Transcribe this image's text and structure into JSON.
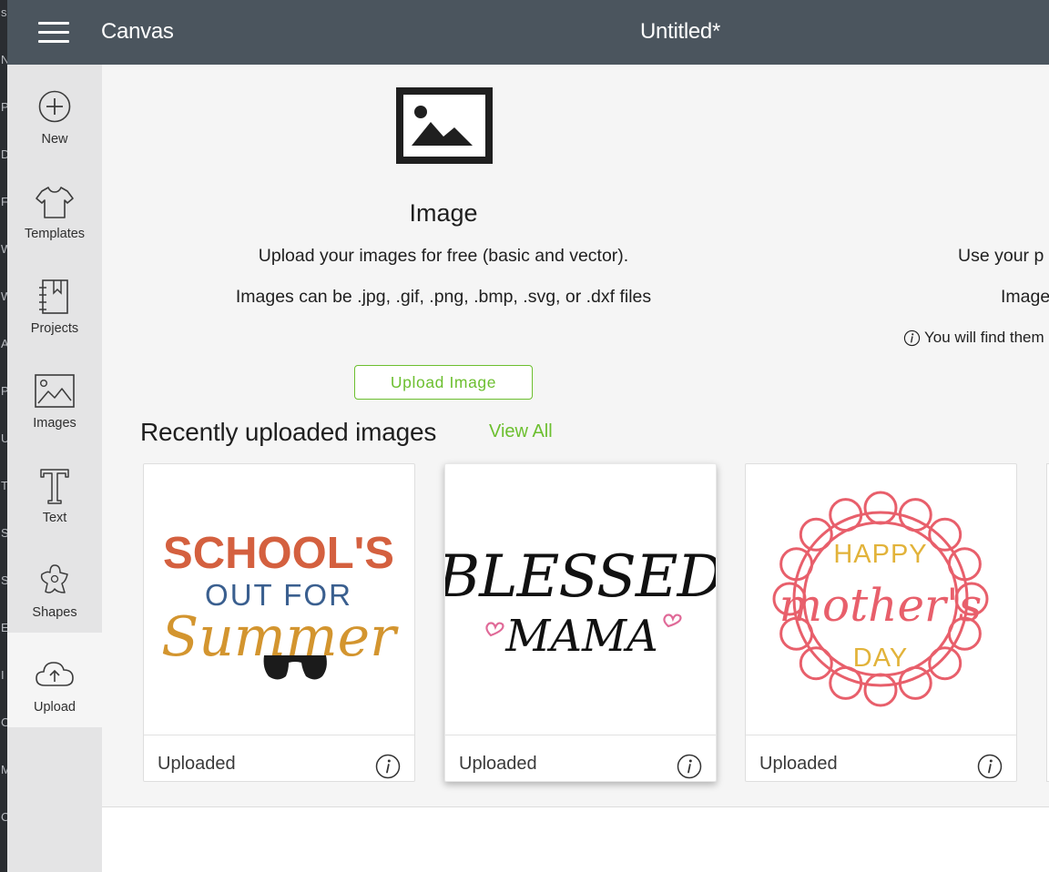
{
  "window": {
    "app_name": "Canvas",
    "doc_title": "Untitled*"
  },
  "edge_letters": [
    "s",
    "N",
    "P",
    "D",
    "F",
    "W",
    "W",
    "A",
    "P",
    "U",
    "T",
    "S",
    "S",
    "E",
    "I",
    "C",
    "M",
    "C"
  ],
  "sidebar": {
    "items": [
      {
        "label": "New",
        "icon": "plus-circle-icon"
      },
      {
        "label": "Templates",
        "icon": "tshirt-icon"
      },
      {
        "label": "Projects",
        "icon": "notebook-icon"
      },
      {
        "label": "Images",
        "icon": "image-icon"
      },
      {
        "label": "Text",
        "icon": "text-t-icon"
      },
      {
        "label": "Shapes",
        "icon": "shapes-icon"
      },
      {
        "label": "Upload",
        "icon": "cloud-upload-icon"
      }
    ],
    "active": "Upload"
  },
  "image_section": {
    "title": "Image",
    "line1": "Upload your images for free (basic and vector).",
    "line2": "Images can be .jpg, .gif, .png, .bmp, .svg, or .dxf files",
    "upload_button": "Upload Image"
  },
  "right_section": {
    "line1": "Use your p",
    "line2": "Image",
    "note": "You will find them"
  },
  "recent": {
    "title": "Recently uploaded images",
    "view_all": "View All",
    "cards": [
      {
        "status": "Uploaded",
        "art": {
          "line1": "SCHOOL'S",
          "line2": "OUT FOR",
          "line3": "Summer"
        }
      },
      {
        "status": "Uploaded",
        "art": {
          "line1": "BLESSED",
          "line2": "MAMA"
        }
      },
      {
        "status": "Uploaded",
        "art": {
          "line1": "HAPPY",
          "line2": "mother's",
          "line3": "DAY"
        }
      }
    ]
  },
  "colors": {
    "topbar": "#4b555e",
    "accent_green": "#6cbf2f",
    "sidebar": "#e4e4e5",
    "panel": "#f5f5f5",
    "art_orange": "#d4603f",
    "art_blue": "#3a5f8f",
    "art_gold": "#d3952f",
    "art_pink": "#e85f6b",
    "art_yellow": "#e2b33a"
  }
}
